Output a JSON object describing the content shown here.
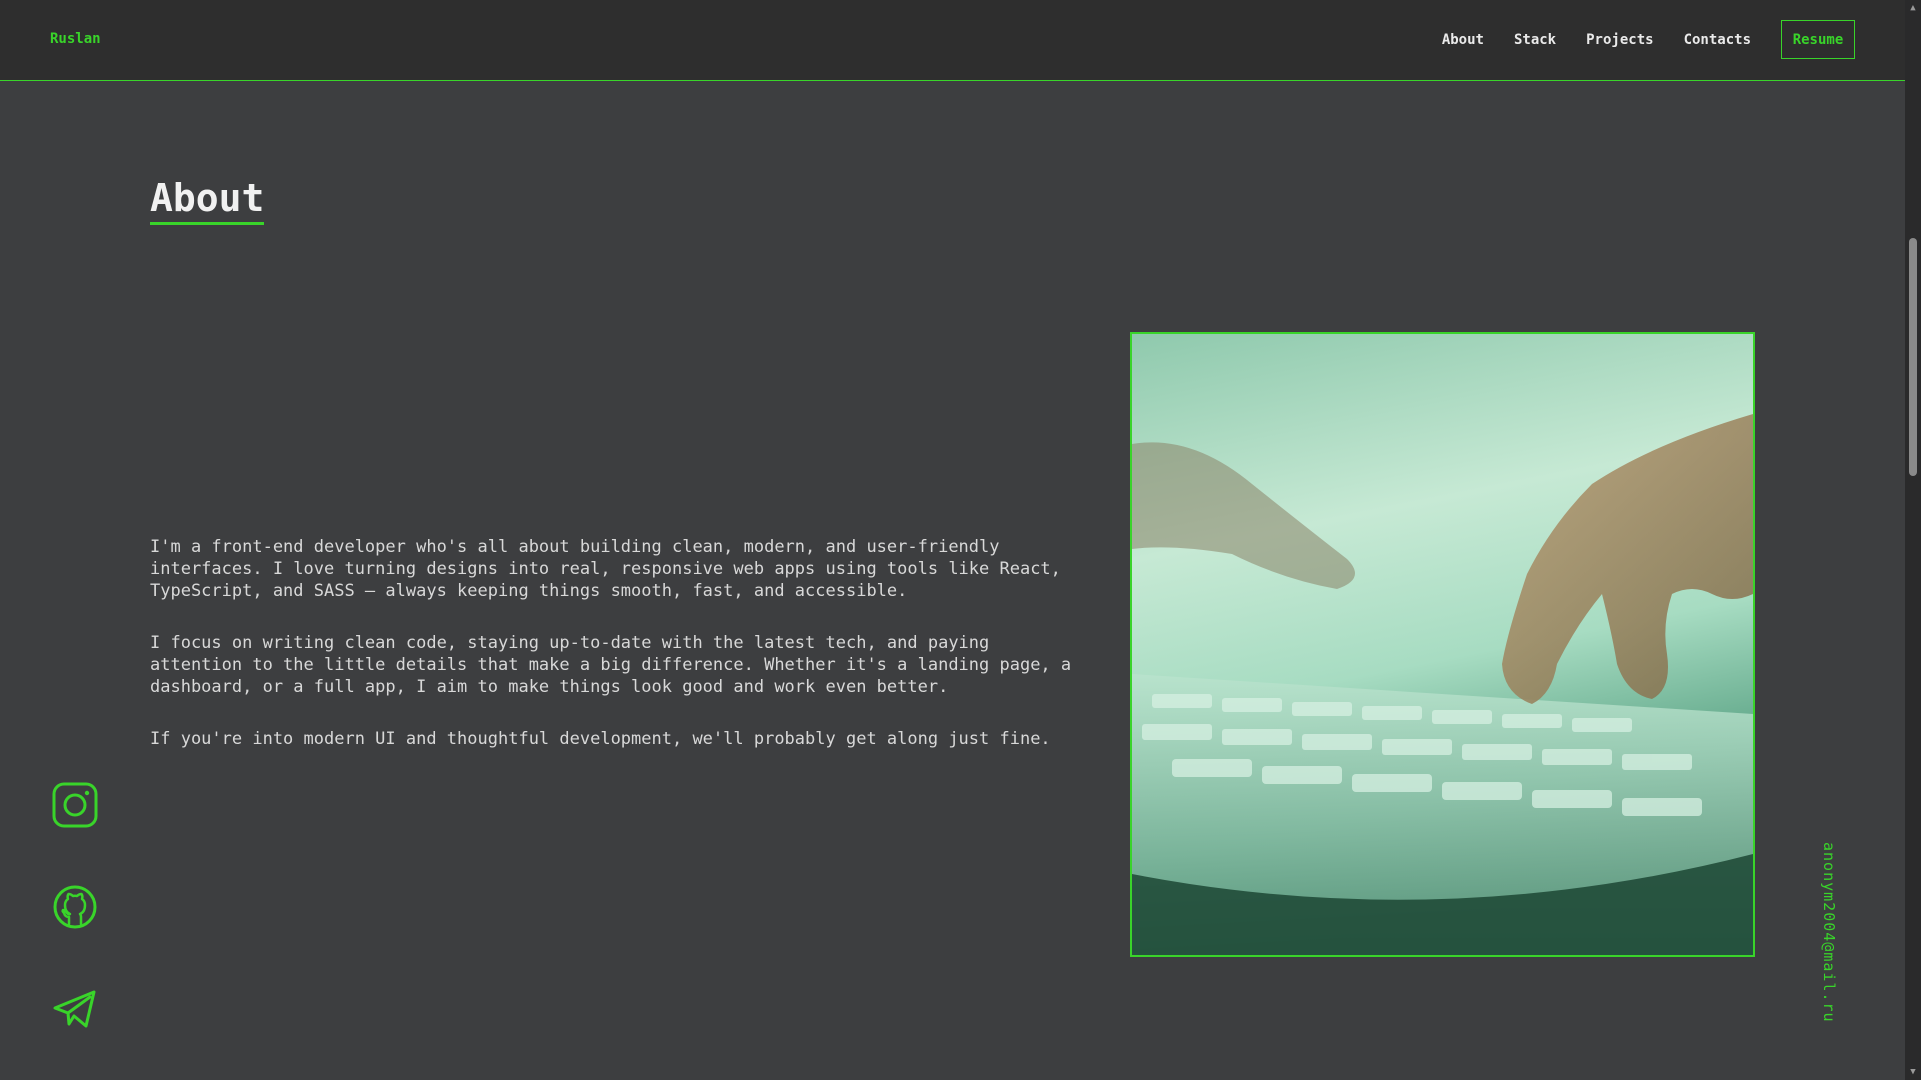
{
  "header": {
    "logo": "Ruslan",
    "nav": [
      {
        "label": "About"
      },
      {
        "label": "Stack"
      },
      {
        "label": "Projects"
      },
      {
        "label": "Contacts"
      }
    ],
    "resume_label": "Resume"
  },
  "about": {
    "title": "About",
    "paragraphs": [
      "I'm a front-end developer who's all about building clean, modern, and user-friendly interfaces. I love turning designs into real, responsive web apps using tools like React, TypeScript, and SASS — always keeping things smooth, fast, and accessible.",
      "I focus on writing clean code, staying up-to-date with the latest tech, and paying attention to the little details that make a big difference. Whether it's a landing page, a dashboard, or a full app, I aim to make things look good and work even better.",
      "If you're into modern UI and thoughtful development, we'll probably get along just fine."
    ]
  },
  "socials": [
    {
      "icon": "instagram-icon"
    },
    {
      "icon": "github-icon"
    },
    {
      "icon": "telegram-icon"
    }
  ],
  "email": "anonym2004@mail.ru",
  "colors": {
    "accent": "#39d42a",
    "background": "#3d3e40",
    "header": "#2e2e2e"
  }
}
